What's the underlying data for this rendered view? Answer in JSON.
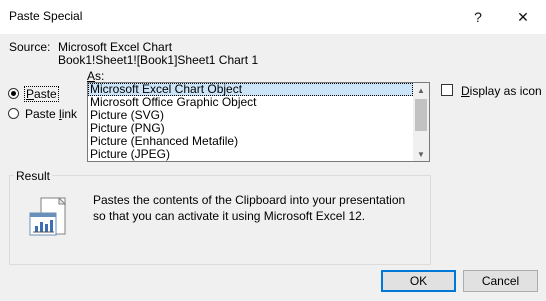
{
  "dialog": {
    "title": "Paste Special",
    "help_icon": "?",
    "close_icon": "✕"
  },
  "source": {
    "label": "Source:",
    "name": "Microsoft Excel Chart",
    "path": "Book1!Sheet1![Book1]Sheet1 Chart 1"
  },
  "paste_options": {
    "as_label_prefix": "",
    "as_label_mnemonic": "A",
    "as_label_rest": "s:",
    "paste_mnemonic": "P",
    "paste_rest": "aste",
    "paste_selected": true,
    "paste_link_prefix": "Paste ",
    "paste_link_mnemonic": "l",
    "paste_link_rest": "ink"
  },
  "as_list": {
    "items": [
      "Microsoft Excel Chart Object",
      "Microsoft Office Graphic Object",
      "Picture (SVG)",
      "Picture (PNG)",
      "Picture (Enhanced Metafile)",
      "Picture (JPEG)"
    ],
    "selected_index": 0,
    "scroll_up_icon": "▲",
    "scroll_down_icon": "▼"
  },
  "display_as_icon": {
    "mnemonic": "D",
    "rest": "isplay as icon",
    "checked": false
  },
  "result": {
    "legend": "Result",
    "description": "Pastes the contents of the Clipboard into your presentation so that you can activate it using Microsoft Excel 12."
  },
  "buttons": {
    "ok": "OK",
    "cancel": "Cancel"
  }
}
